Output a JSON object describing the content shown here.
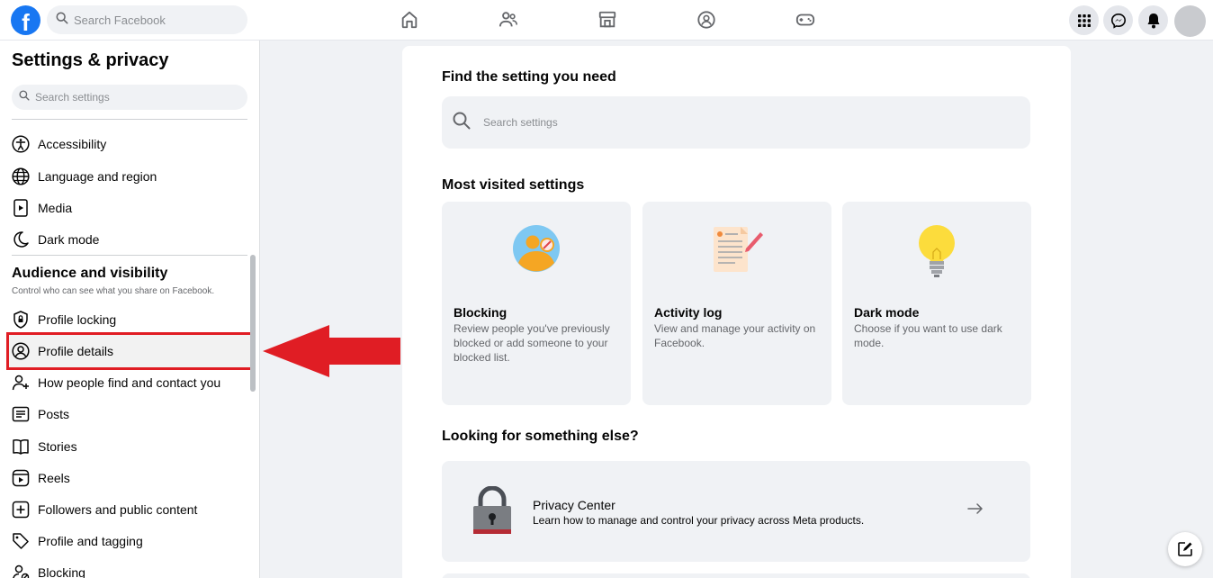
{
  "topbar": {
    "logo": "f",
    "search_placeholder": "Search Facebook",
    "nav_icons": [
      "home-icon",
      "friends-icon",
      "marketplace-icon",
      "groups-icon",
      "gaming-icon"
    ],
    "right_icons": [
      "menu-grid-icon",
      "messenger-icon",
      "notifications-icon",
      "account-avatar"
    ]
  },
  "sidebar": {
    "title": "Settings & privacy",
    "search_placeholder": "Search settings",
    "preferences": [
      {
        "label": "Accessibility",
        "icon": "accessibility-icon"
      },
      {
        "label": "Language and region",
        "icon": "globe-icon"
      },
      {
        "label": "Media",
        "icon": "media-icon"
      },
      {
        "label": "Dark mode",
        "icon": "moon-icon"
      }
    ],
    "audience_heading": "Audience and visibility",
    "audience_subtitle": "Control who can see what you share on Facebook.",
    "audience_items": [
      {
        "label": "Profile locking",
        "icon": "shield-icon"
      },
      {
        "label": "Profile details",
        "icon": "profile-circle-icon"
      },
      {
        "label": "How people find and contact you",
        "icon": "person-add-icon"
      },
      {
        "label": "Posts",
        "icon": "posts-icon"
      },
      {
        "label": "Stories",
        "icon": "book-icon"
      },
      {
        "label": "Reels",
        "icon": "reels-icon"
      },
      {
        "label": "Followers and public content",
        "icon": "plus-square-icon"
      },
      {
        "label": "Profile and tagging",
        "icon": "tag-icon"
      },
      {
        "label": "Blocking",
        "icon": "block-person-icon"
      }
    ]
  },
  "main": {
    "find_heading": "Find the setting you need",
    "search_placeholder": "Search settings",
    "most_visited_heading": "Most visited settings",
    "tiles": [
      {
        "title": "Blocking",
        "description": "Review people you've previously blocked or add someone to your blocked list."
      },
      {
        "title": "Activity log",
        "description": "View and manage your activity on Facebook."
      },
      {
        "title": "Dark mode",
        "description": "Choose if you want to use dark mode."
      }
    ],
    "looking_heading": "Looking for something else?",
    "privacy_center": {
      "title": "Privacy Center",
      "description": "Learn how to manage and control your privacy across Meta products."
    }
  },
  "colors": {
    "brand": "#1877f2",
    "highlight": "#e01d24"
  }
}
